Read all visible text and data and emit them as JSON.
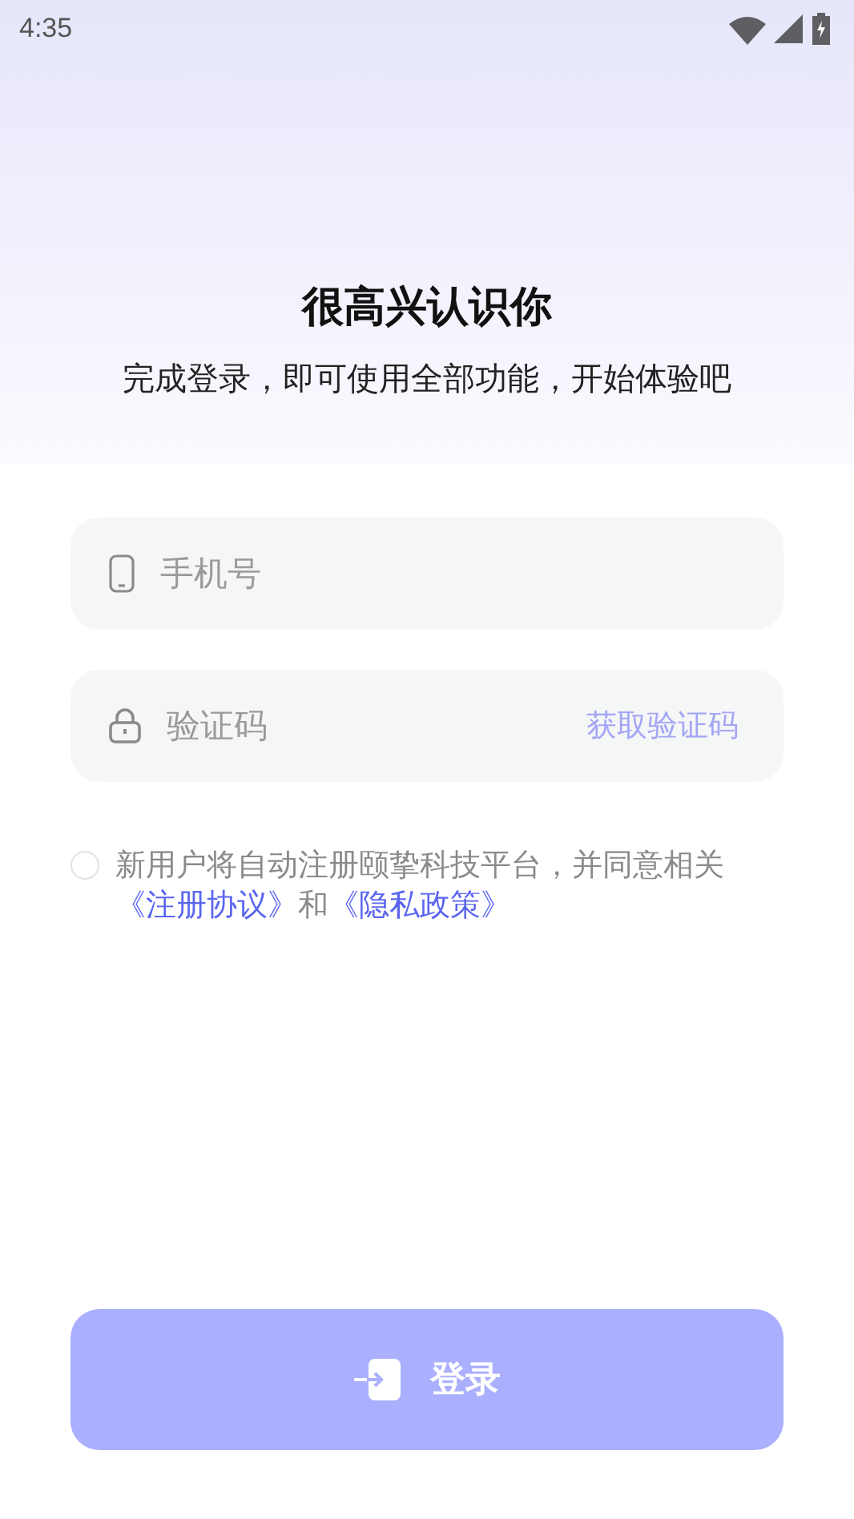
{
  "status_bar": {
    "time": "4:35"
  },
  "header": {
    "title": "很高兴认识你",
    "subtitle": "完成登录，即可使用全部功能，开始体验吧"
  },
  "phone_field": {
    "placeholder": "手机号"
  },
  "code_field": {
    "placeholder": "验证码",
    "action": "获取验证码"
  },
  "agreement": {
    "checked": false,
    "parts": [
      {
        "kind": "text",
        "text": "新用户将自动注册颐挚科技平台，并同意相关"
      },
      {
        "kind": "link",
        "text": "《注册协议》"
      },
      {
        "kind": "text",
        "text": "和"
      },
      {
        "kind": "link",
        "text": "《隐私政策》"
      }
    ]
  },
  "login_button": {
    "label": "登录"
  }
}
